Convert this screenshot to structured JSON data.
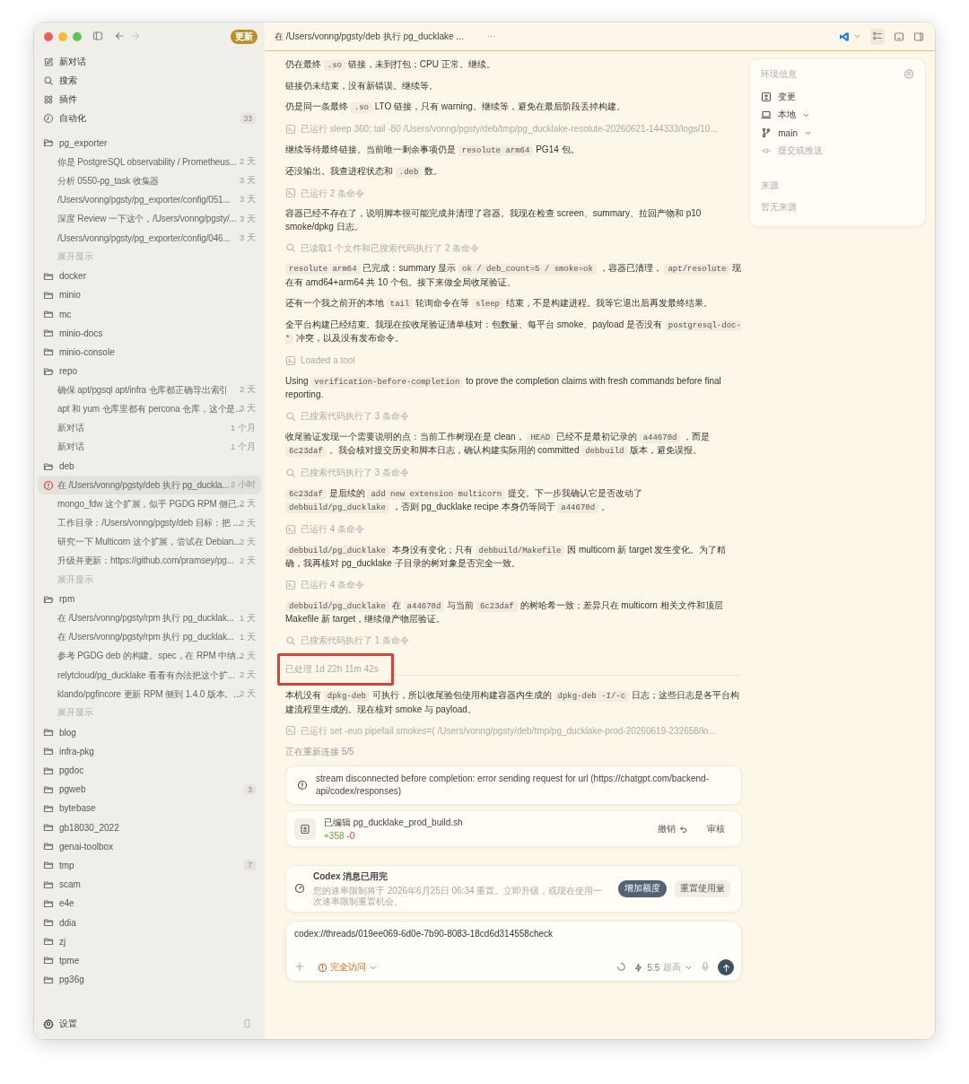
{
  "window": {
    "update_badge": "更新",
    "title": "在 /Users/vonng/pgsty/deb 执行 pg_ducklake ...",
    "more": "···"
  },
  "sidebar": {
    "nav": [
      {
        "kind": "compose",
        "label": "新对话"
      },
      {
        "kind": "search",
        "label": "搜索"
      },
      {
        "kind": "plugins",
        "label": "插件"
      },
      {
        "kind": "automation",
        "label": "自动化",
        "badge": "33"
      }
    ],
    "projects": [
      {
        "name": "pg_exporter",
        "expanded": true,
        "threads": [
          {
            "title": "你是 PostgreSQL observability / Prometheus...",
            "time": "2 天",
            "selected": false,
            "error": false
          },
          {
            "title": "分析 0550-pg_task 收集器",
            "time": "3 天",
            "selected": false,
            "error": false
          },
          {
            "title": "/Users/vonng/pgsty/pg_exporter/config/051...",
            "time": "3 天",
            "selected": false,
            "error": false
          },
          {
            "title": "深度 Review 一下这个，/Users/vonng/pgsty/...",
            "time": "3 天",
            "selected": false,
            "error": false
          },
          {
            "title": "/Users/vonng/pgsty/pg_exporter/config/046...",
            "time": "3 天",
            "selected": false,
            "error": false
          }
        ],
        "more": "展开显示"
      },
      {
        "name": "docker",
        "expanded": false
      },
      {
        "name": "minio",
        "expanded": false
      },
      {
        "name": "mc",
        "expanded": false
      },
      {
        "name": "minio-docs",
        "expanded": false
      },
      {
        "name": "minio-console",
        "expanded": false
      },
      {
        "name": "repo",
        "expanded": true,
        "threads": [
          {
            "title": "确保 apt/pgsql apt/infra 仓库都正确导出索引",
            "time": "2 天",
            "selected": false,
            "error": false
          },
          {
            "title": "apt 和 yum 仓库里都有 percona 仓库，这个是...",
            "time": "3 天",
            "selected": false,
            "error": false
          },
          {
            "title": "新对话",
            "time": "1 个月",
            "selected": false,
            "error": false
          },
          {
            "title": "新对话",
            "time": "1 个月",
            "selected": false,
            "error": false
          }
        ]
      },
      {
        "name": "deb",
        "expanded": true,
        "threads": [
          {
            "title": "在 /Users/vonng/pgsty/deb 执行 pg_duckla...",
            "time": "2 小时",
            "selected": true,
            "error": true
          },
          {
            "title": "mongo_fdw 这个扩展，似乎 PGDG RPM 侧已...",
            "time": "2 天",
            "selected": false,
            "error": false
          },
          {
            "title": "工作目录：/Users/vonng/pgsty/deb 目标：把 ...",
            "time": "2 天",
            "selected": false,
            "error": false
          },
          {
            "title": "研究一下 Multicorn 这个扩展，尝试在 Debian...",
            "time": "2 天",
            "selected": false,
            "error": false
          },
          {
            "title": "升级并更新：https://github.com/pramsey/pg...",
            "time": "2 天",
            "selected": false,
            "error": false
          }
        ],
        "more": "展开显示"
      },
      {
        "name": "rpm",
        "expanded": true,
        "threads": [
          {
            "title": "在 /Users/vonng/pgsty/rpm 执行 pg_ducklak...",
            "time": "1 天",
            "selected": false,
            "error": false
          },
          {
            "title": "在 /Users/vonng/pgsty/rpm 执行 pg_ducklak...",
            "time": "1 天",
            "selected": false,
            "error": false
          },
          {
            "title": "参考 PGDG deb 的构建。spec，在 RPM 中纳...",
            "time": "2 天",
            "selected": false,
            "error": false
          },
          {
            "title": "relytcloud/pg_ducklake 看看有办法把这个扩...",
            "time": "2 天",
            "selected": false,
            "error": false
          },
          {
            "title": "klando/pgfincore 更新 RPM 侧到 1.4.0 版本。...",
            "time": "2 天",
            "selected": false,
            "error": false
          }
        ],
        "more": "展开显示"
      },
      {
        "name": "blog",
        "expanded": false
      },
      {
        "name": "infra-pkg",
        "expanded": false
      },
      {
        "name": "pgdoc",
        "expanded": false
      },
      {
        "name": "pgweb",
        "expanded": false,
        "badge": "3"
      },
      {
        "name": "bytebase",
        "expanded": false
      },
      {
        "name": "gb18030_2022",
        "expanded": false
      },
      {
        "name": "genai-toolbox",
        "expanded": false
      },
      {
        "name": "tmp",
        "expanded": false,
        "badge": "7"
      },
      {
        "name": "scam",
        "expanded": false
      },
      {
        "name": "e4e",
        "expanded": false
      },
      {
        "name": "ddia",
        "expanded": false
      },
      {
        "name": "zj",
        "expanded": false
      },
      {
        "name": "tpme",
        "expanded": false
      },
      {
        "name": "pg36g",
        "expanded": false
      }
    ],
    "settings": "设置"
  },
  "messages": [
    {
      "kind": "text",
      "parts": [
        {
          "kind": "plain",
          "text": "仍在最终 "
        },
        {
          "kind": "code",
          "text": ".so"
        },
        {
          "kind": "plain",
          "text": " 链接，未到打包；CPU 正常。继续。"
        }
      ]
    },
    {
      "kind": "text",
      "parts": [
        {
          "kind": "plain",
          "text": "链接仍未结束，没有新错误。继续等。"
        }
      ]
    },
    {
      "kind": "text",
      "parts": [
        {
          "kind": "plain",
          "text": "仍是同一条最终 "
        },
        {
          "kind": "code",
          "text": ".so"
        },
        {
          "kind": "plain",
          "text": " LTO 链接，只有 warning。继续等，避免在最后阶段丢掉构建。"
        }
      ]
    },
    {
      "kind": "command",
      "text": "已运行 sleep 360; tail -80 /Users/vonng/pgsty/deb/tmp/pg_ducklake-resolute-20260621-144333/logs/10..."
    },
    {
      "kind": "text",
      "parts": [
        {
          "kind": "plain",
          "text": "继续等待最终链接。当前唯一剩余事项仍是 "
        },
        {
          "kind": "code",
          "text": "resolute arm64"
        },
        {
          "kind": "plain",
          "text": " PG14 包。"
        }
      ]
    },
    {
      "kind": "text",
      "parts": [
        {
          "kind": "plain",
          "text": "还没输出。我查进程状态和 "
        },
        {
          "kind": "code",
          "text": ".deb"
        },
        {
          "kind": "plain",
          "text": " 数。"
        }
      ]
    },
    {
      "kind": "command",
      "text": "已运行 2 条命令"
    },
    {
      "kind": "text",
      "parts": [
        {
          "kind": "plain",
          "text": "容器已经不存在了，说明脚本很可能完成并清理了容器。我现在检查 screen、summary、拉回产物和 p10 smoke/dpkg 日志。"
        }
      ]
    },
    {
      "kind": "search",
      "text": "已读取1 个文件和已搜索代码执行了 2 条命令"
    },
    {
      "kind": "text",
      "parts": [
        {
          "kind": "code",
          "text": "resolute arm64"
        },
        {
          "kind": "plain",
          "text": " 已完成：summary 显示 "
        },
        {
          "kind": "code",
          "text": "ok / deb_count=5 / smoke=ok"
        },
        {
          "kind": "plain",
          "text": " ，容器已清理， "
        },
        {
          "kind": "code",
          "text": "apt/resolute"
        },
        {
          "kind": "plain",
          "text": " 现在有 amd64+arm64 共 10 个包。接下来做全局收尾验证。"
        }
      ]
    },
    {
      "kind": "text",
      "parts": [
        {
          "kind": "plain",
          "text": "还有一个我之前开的本地 "
        },
        {
          "kind": "code",
          "text": "tail"
        },
        {
          "kind": "plain",
          "text": " 轮询命令在等 "
        },
        {
          "kind": "code",
          "text": "sleep"
        },
        {
          "kind": "plain",
          "text": " 结束，不是构建进程。我等它退出后再发最终结果。"
        }
      ]
    },
    {
      "kind": "text",
      "parts": [
        {
          "kind": "plain",
          "text": "全平台构建已经结束。我现在按收尾验证清单核对：包数量、每平台 smoke、payload 是否没有 "
        },
        {
          "kind": "code",
          "text": "postgresql-doc-*"
        },
        {
          "kind": "plain",
          "text": " 冲突，以及没有发布命令。"
        }
      ]
    },
    {
      "kind": "command",
      "text": "Loaded a tool"
    },
    {
      "kind": "text",
      "parts": [
        {
          "kind": "plain",
          "text": "Using "
        },
        {
          "kind": "code",
          "text": "verification-before-completion"
        },
        {
          "kind": "plain",
          "text": " to prove the completion claims with fresh commands before final reporting."
        }
      ]
    },
    {
      "kind": "search",
      "text": "已搜索代码执行了 3 条命令"
    },
    {
      "kind": "text",
      "parts": [
        {
          "kind": "plain",
          "text": "收尾验证发现一个需要说明的点：当前工作树现在是 clean， "
        },
        {
          "kind": "code",
          "text": "HEAD"
        },
        {
          "kind": "plain",
          "text": " 已经不是最初记录的 "
        },
        {
          "kind": "code",
          "text": "a44670d"
        },
        {
          "kind": "plain",
          "text": " ，而是 "
        },
        {
          "kind": "code",
          "text": "6c23daf"
        },
        {
          "kind": "plain",
          "text": " 。我会核对提交历史和脚本日志，确认构建实际用的 committed "
        },
        {
          "kind": "code",
          "text": "debbuild"
        },
        {
          "kind": "plain",
          "text": " 版本，避免误报。"
        }
      ]
    },
    {
      "kind": "search",
      "text": "已搜索代码执行了 3 条命令"
    },
    {
      "kind": "text",
      "parts": [
        {
          "kind": "code",
          "text": "6c23daf"
        },
        {
          "kind": "plain",
          "text": " 是后续的 "
        },
        {
          "kind": "code",
          "text": "add new extension multicorn"
        },
        {
          "kind": "plain",
          "text": " 提交。下一步我确认它是否改动了 "
        },
        {
          "kind": "code",
          "text": "debbuild/pg_ducklake"
        },
        {
          "kind": "plain",
          "text": " ，否则 pg_ducklake recipe 本身仍等同于 "
        },
        {
          "kind": "code",
          "text": "a44670d"
        },
        {
          "kind": "plain",
          "text": " 。"
        }
      ]
    },
    {
      "kind": "command",
      "text": "已运行 4 条命令"
    },
    {
      "kind": "text",
      "parts": [
        {
          "kind": "code",
          "text": "debbuild/pg_ducklake"
        },
        {
          "kind": "plain",
          "text": " 本身没有变化；只有 "
        },
        {
          "kind": "code",
          "text": "debbuild/Makefile"
        },
        {
          "kind": "plain",
          "text": " 因 multicorn 新 target 发生变化。为了精确，我再核对 pg_ducklake 子目录的树对象是否完全一致。"
        }
      ]
    },
    {
      "kind": "command",
      "text": "已运行 4 条命令"
    },
    {
      "kind": "text",
      "parts": [
        {
          "kind": "code",
          "text": "debbuild/pg_ducklake"
        },
        {
          "kind": "plain",
          "text": " 在 "
        },
        {
          "kind": "code",
          "text": "a44670d"
        },
        {
          "kind": "plain",
          "text": " 与当前 "
        },
        {
          "kind": "code",
          "text": "6c23daf"
        },
        {
          "kind": "plain",
          "text": " 的树哈希一致；差异只在 multicorn 相关文件和顶层 Makefile 新 target，继续做产物层验证。"
        }
      ]
    },
    {
      "kind": "search",
      "text": "已搜索代码执行了 1 条命令"
    },
    {
      "kind": "elapsed",
      "text": "已处理 1d 22h 11m 42s",
      "highlighted": true
    },
    {
      "kind": "text",
      "parts": [
        {
          "kind": "plain",
          "text": "本机没有 "
        },
        {
          "kind": "code",
          "text": "dpkg-deb"
        },
        {
          "kind": "plain",
          "text": " 可执行，所以收尾验包使用构建容器内生成的 "
        },
        {
          "kind": "code",
          "text": "dpkg-deb -I/-c"
        },
        {
          "kind": "plain",
          "text": " 日志；这些日志是各平台构建流程里生成的。现在核对 smoke 与 payload。"
        }
      ]
    },
    {
      "kind": "command",
      "text": "已运行 set -euo pipefail smokes=( /Users/vonng/pgsty/deb/tmp/pg_ducklake-prod-20260619-232658/lo..."
    },
    {
      "kind": "status",
      "text": "正在重新连接 5/5"
    }
  ],
  "error_card": {
    "message": "stream disconnected before completion: error sending request for url (https://chatgpt.com/backend-api/codex/responses)"
  },
  "edit_card": {
    "title": "已编辑 pg_ducklake_prod_build.sh",
    "additions": "+358",
    "deletions": "-0",
    "undo": "撤销",
    "review": "审核"
  },
  "limit_card": {
    "title": "Codex 消息已用完",
    "message": "您的速率限制将于 2026年6月25日 06:34 重置。立即升级，或现在使用一次速率限制重置机会。",
    "primary": "增加额度",
    "secondary": "重置使用量"
  },
  "composer": {
    "value": "codex://threads/019ee069-6d0e-7b90-8083-18cd6d314558check",
    "access": "完全访问",
    "model": "5.5",
    "effort": "超高"
  },
  "env_panel": {
    "title": "环境信息",
    "items": [
      {
        "kind": "changes",
        "label": "变更",
        "dropdown": false,
        "disabled": false
      },
      {
        "kind": "local",
        "label": "本地",
        "dropdown": true,
        "disabled": false
      },
      {
        "kind": "branch",
        "label": "main",
        "dropdown": true,
        "disabled": false
      },
      {
        "kind": "commit",
        "label": "提交或推送",
        "dropdown": false,
        "disabled": true
      }
    ],
    "sources_title": "来源",
    "sources_empty": "暂无来源"
  }
}
